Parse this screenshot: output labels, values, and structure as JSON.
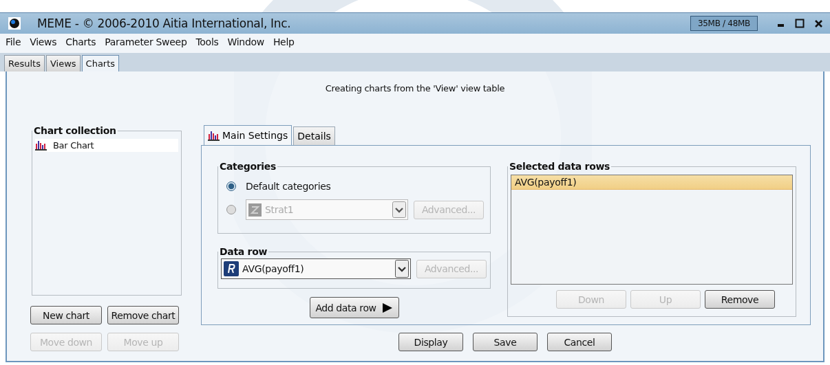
{
  "window": {
    "title": "MEME - © 2006-2010 Aitia International, Inc.",
    "memory": "35MB / 48MB"
  },
  "menu": [
    "File",
    "Views",
    "Charts",
    "Parameter Sweep",
    "Tools",
    "Window",
    "Help"
  ],
  "tabs": [
    {
      "label": "Results",
      "selected": false
    },
    {
      "label": "Views",
      "selected": false
    },
    {
      "label": "Charts",
      "selected": true
    }
  ],
  "header": "Creating charts from the 'View' view table",
  "chart_collection": {
    "title": "Chart collection",
    "items": [
      {
        "label": "Bar Chart",
        "selected": true
      }
    ],
    "buttons": [
      {
        "label": "New chart",
        "disabled": false
      },
      {
        "label": "Remove chart",
        "disabled": false
      },
      {
        "label": "Move down",
        "disabled": true
      },
      {
        "label": "Move up",
        "disabled": true
      }
    ]
  },
  "settings_tabs": [
    {
      "label": "Main Settings",
      "selected": true,
      "kind": "chart"
    },
    {
      "label": "Details",
      "selected": false,
      "kind": "plain"
    }
  ],
  "categories": {
    "title": "Categories",
    "options": [
      {
        "kind": "label",
        "label": "Default categories",
        "selected": true
      },
      {
        "kind": "combo",
        "value": "Strat1",
        "selected": false,
        "disabled": true,
        "advanced": {
          "label": "Advanced...",
          "disabled": true
        }
      }
    ]
  },
  "data_row": {
    "title": "Data row",
    "value": "AVG(payoff1)",
    "disabled": false,
    "advanced": {
      "label": "Advanced...",
      "disabled": true
    }
  },
  "add_button": {
    "label": "Add data row",
    "disabled": false
  },
  "selected_rows": {
    "title": "Selected data rows",
    "rows": [
      {
        "label": "AVG(payoff1)",
        "selected": true
      }
    ],
    "buttons": [
      {
        "label": "Down",
        "disabled": true
      },
      {
        "label": "Up",
        "disabled": true
      },
      {
        "label": "Remove",
        "disabled": false
      }
    ]
  },
  "footer_buttons": [
    {
      "label": "Display",
      "disabled": false
    },
    {
      "label": "Save",
      "disabled": false
    },
    {
      "label": "Cancel",
      "disabled": false
    }
  ]
}
